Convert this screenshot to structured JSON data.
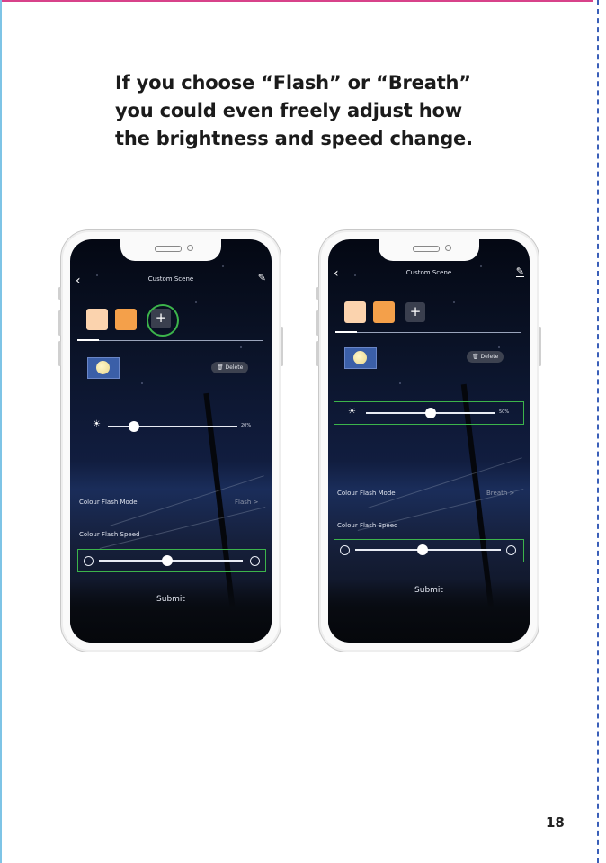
{
  "heading": {
    "line1": "If you choose “Flash” or “Breath”",
    "line2": "you could even freely adjust how",
    "line3": "the brightness and speed change."
  },
  "page_number": "18",
  "accent_colors": {
    "highlight": "#3cb44b",
    "swatch_light": "#fbd3ae",
    "swatch_orange": "#f4a04a"
  },
  "phones": [
    {
      "title": "Custom Scene",
      "add_label": "+",
      "delete_label": "Delete",
      "brightness_value": "20%",
      "brightness_level": 0.2,
      "mode_label": "Colour Flash Mode",
      "mode_value": "Flash >",
      "speed_label": "Colour Flash Speed",
      "submit_label": "Submit"
    },
    {
      "title": "Custom Scene",
      "add_label": "+",
      "delete_label": "Delete",
      "brightness_value": "50%",
      "brightness_level": 0.5,
      "mode_label": "Colour Flash Mode",
      "mode_value": "Breath >",
      "speed_label": "Colour Flash Speed",
      "submit_label": "Submit"
    }
  ]
}
